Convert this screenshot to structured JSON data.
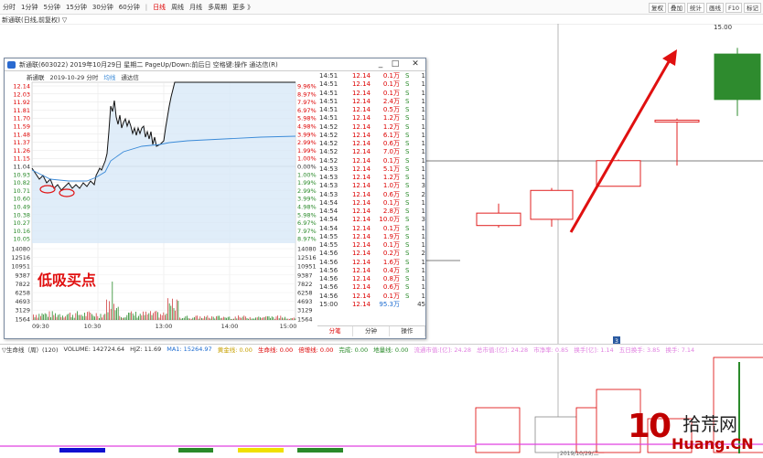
{
  "toolbar": {
    "periods": [
      "分时",
      "1分钟",
      "5分钟",
      "15分钟",
      "30分钟",
      "60分钟",
      "日线",
      "周线",
      "月线",
      "多周期",
      "更多 》"
    ],
    "active_period": "日线",
    "right_buttons": [
      "复权",
      "叠加",
      "统计",
      "画线",
      "F10",
      "标记"
    ]
  },
  "stock_info": "新通联(日线,前复权) ▽",
  "main_chart": {
    "price_label": "15.00",
    "candles": [
      {
        "open": 10.25,
        "close": 10.55,
        "high": 10.78,
        "low": 10.2,
        "color": "red"
      },
      {
        "open": 10.4,
        "close": 11.1,
        "high": 11.16,
        "low": 10.22,
        "color": "red"
      },
      {
        "open": 11.2,
        "close": 11.82,
        "high": 11.85,
        "low": 11.2,
        "color": "red"
      },
      {
        "open": 12.8,
        "close": 12.8,
        "high": 12.84,
        "low": 11.7,
        "color": "red"
      },
      {
        "open": 14.4,
        "close": 13.3,
        "high": 14.55,
        "low": 12.9,
        "color": "green"
      }
    ]
  },
  "sub_header": {
    "items": [
      "▽生命线（周）(120)",
      "VOLUME: 142724.64",
      "HJZ: 11.69",
      "MA1: 15264.97",
      "黄金线: 0.00",
      "生命线: 0.00",
      "倍增线: 0.00",
      "完成: 0.00",
      "地量线: 0.00",
      "流通市值:[亿]: 24.28",
      "总市值:[亿]: 24.28",
      "市净率: 0.85",
      "换手[亿]: 1.14",
      "五日换手: 3.85",
      "换手: 7.14"
    ]
  },
  "popup": {
    "title": "新通联(603022)  2019年10月29日  星期二  PageUp/Down:前后日  空格键:操作  通达信(R)",
    "window_buttons": [
      "_",
      "□",
      "✕"
    ],
    "sub_info": [
      "新通联",
      "2019-10-29 分时",
      "均线",
      "通达信"
    ],
    "price_axis_left": [
      "12.14",
      "12.03",
      "11.92",
      "11.81",
      "11.70",
      "11.59",
      "11.48",
      "11.37",
      "11.26",
      "11.15",
      "11.04",
      "10.93",
      "10.82",
      "10.71",
      "10.60",
      "10.49",
      "10.38",
      "10.27",
      "10.16",
      "10.05"
    ],
    "pct_axis_right": [
      "9.96%",
      "8.97%",
      "7.97%",
      "6.97%",
      "5.98%",
      "4.98%",
      "3.99%",
      "2.99%",
      "1.99%",
      "1.00%",
      "0.00%",
      "1.00%",
      "1.99%",
      "2.99%",
      "3.99%",
      "4.98%",
      "5.98%",
      "6.97%",
      "7.97%",
      "8.97%"
    ],
    "volume_axis": [
      "14080",
      "12516",
      "10951",
      "9387",
      "7822",
      "6258",
      "4693",
      "3129",
      "1564"
    ],
    "time_axis": [
      "09:30",
      "10:30",
      "13:00",
      "14:00",
      "15:00"
    ],
    "trades": [
      {
        "time": "14:51",
        "price": "12.14",
        "vol": "0.1万",
        "side": "S",
        "count": "1"
      },
      {
        "time": "14:51",
        "price": "12.14",
        "vol": "0.1万",
        "side": "S",
        "count": "1"
      },
      {
        "time": "14:51",
        "price": "12.14",
        "vol": "0.1万",
        "side": "S",
        "count": "1"
      },
      {
        "time": "14:51",
        "price": "12.14",
        "vol": "2.4万",
        "side": "S",
        "count": "1"
      },
      {
        "time": "14:51",
        "price": "12.14",
        "vol": "0.5万",
        "side": "S",
        "count": "1"
      },
      {
        "time": "14:51",
        "price": "12.14",
        "vol": "1.2万",
        "side": "S",
        "count": "1"
      },
      {
        "time": "14:52",
        "price": "12.14",
        "vol": "1.2万",
        "side": "S",
        "count": "1"
      },
      {
        "time": "14:52",
        "price": "12.14",
        "vol": "6.1万",
        "side": "S",
        "count": "1"
      },
      {
        "time": "14:52",
        "price": "12.14",
        "vol": "0.6万",
        "side": "S",
        "count": "1"
      },
      {
        "time": "14:52",
        "price": "12.14",
        "vol": "7.0万",
        "side": "S",
        "count": "1"
      },
      {
        "time": "14:52",
        "price": "12.14",
        "vol": "0.1万",
        "side": "S",
        "count": "1"
      },
      {
        "time": "14:53",
        "price": "12.14",
        "vol": "5.1万",
        "side": "S",
        "count": "1"
      },
      {
        "time": "14:53",
        "price": "12.14",
        "vol": "1.2万",
        "side": "S",
        "count": "1"
      },
      {
        "time": "14:53",
        "price": "12.14",
        "vol": "1.0万",
        "side": "S",
        "count": "3"
      },
      {
        "time": "14:53",
        "price": "12.14",
        "vol": "0.6万",
        "side": "S",
        "count": "2"
      },
      {
        "time": "14:54",
        "price": "12.14",
        "vol": "0.1万",
        "side": "S",
        "count": "1"
      },
      {
        "time": "14:54",
        "price": "12.14",
        "vol": "2.8万",
        "side": "S",
        "count": "1"
      },
      {
        "time": "14:54",
        "price": "12.14",
        "vol": "10.0万",
        "side": "S",
        "count": "3"
      },
      {
        "time": "14:54",
        "price": "12.14",
        "vol": "0.1万",
        "side": "S",
        "count": "1"
      },
      {
        "time": "14:55",
        "price": "12.14",
        "vol": "1.9万",
        "side": "S",
        "count": "1"
      },
      {
        "time": "14:55",
        "price": "12.14",
        "vol": "0.1万",
        "side": "S",
        "count": "1"
      },
      {
        "time": "14:56",
        "price": "12.14",
        "vol": "0.2万",
        "side": "S",
        "count": "2"
      },
      {
        "time": "14:56",
        "price": "12.14",
        "vol": "1.6万",
        "side": "S",
        "count": "1"
      },
      {
        "time": "14:56",
        "price": "12.14",
        "vol": "0.4万",
        "side": "S",
        "count": "1"
      },
      {
        "time": "14:56",
        "price": "12.14",
        "vol": "0.8万",
        "side": "S",
        "count": "1"
      },
      {
        "time": "14:56",
        "price": "12.14",
        "vol": "0.6万",
        "side": "S",
        "count": "1"
      },
      {
        "time": "14:56",
        "price": "12.14",
        "vol": "0.1万",
        "side": "S",
        "count": "1"
      },
      {
        "time": "15:00",
        "price": "12.14",
        "vol": "95.3万",
        "side": "",
        "count": "45"
      }
    ],
    "tabs": [
      "分笔",
      "分钟",
      "操作"
    ],
    "active_tab": "分笔",
    "annotation": "低吸买点"
  },
  "date_label": "2019/10/29/二",
  "badge": "3",
  "watermark": {
    "num": "10",
    "cn": "拾荒网",
    "domain": "Huang.CN"
  },
  "colors": {
    "up": "#e02020",
    "down": "#2e8b2e",
    "arrow": "#e01010",
    "intraday_fill": "#d8e8f8",
    "avg_line": "#3a8ad8"
  }
}
